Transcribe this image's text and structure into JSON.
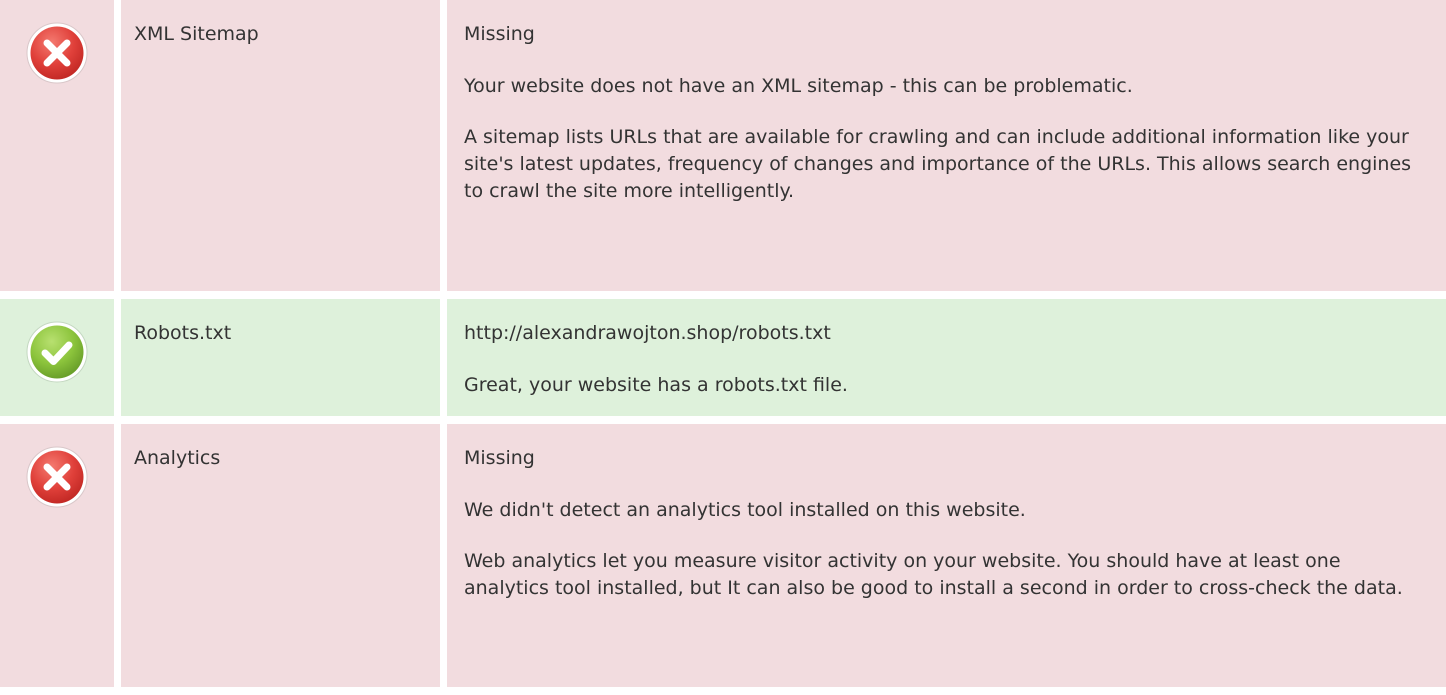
{
  "rows": [
    {
      "status": "fail",
      "icon": "error-x-icon",
      "name": "XML Sitemap",
      "result": "Missing",
      "paragraphs": [
        "Your website does not have an XML sitemap - this can be problematic.",
        "A sitemap lists URLs that are available for crawling and can include additional information like your site's latest updates, frequency of changes and importance of the URLs. This allows search engines to crawl the site more intelligently."
      ]
    },
    {
      "status": "pass",
      "icon": "success-check-icon",
      "name": "Robots.txt",
      "result": "http://alexandrawojton.shop/robots.txt",
      "paragraphs": [
        "Great, your website has a robots.txt file."
      ]
    },
    {
      "status": "fail",
      "icon": "error-x-icon",
      "name": "Analytics",
      "result": "Missing",
      "paragraphs": [
        "We didn't detect an analytics tool installed on this website.",
        "Web analytics let you measure visitor activity on your website. You should have at least one analytics tool installed, but It can also be good to install a second in order to cross-check the data."
      ]
    }
  ],
  "colors": {
    "fail_background": "#f2dcdf",
    "pass_background": "#def1db",
    "fail_icon": "#e0403a",
    "pass_icon": "#8cc43c",
    "text": "#333333"
  }
}
